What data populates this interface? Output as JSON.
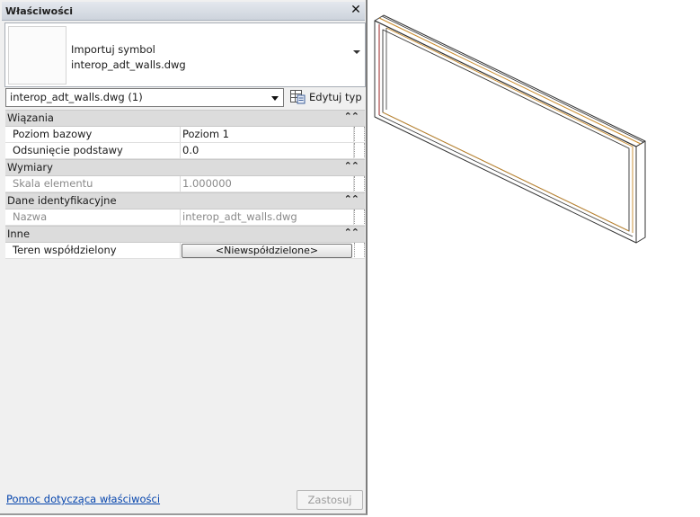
{
  "panel": {
    "title": "Właściwości",
    "close_glyph": "✕",
    "type_selector": {
      "line1": "Importuj symbol",
      "line2": "interop_adt_walls.dwg"
    },
    "instance_select": "interop_adt_walls.dwg (1)",
    "edit_type_label": "Edytuj typ",
    "categories": [
      {
        "name": "Wiązania",
        "rows": [
          {
            "label": "Poziom bazowy",
            "value": "Poziom 1"
          },
          {
            "label": "Odsunięcie podstawy",
            "value": "0.0"
          }
        ]
      },
      {
        "name": "Wymiary",
        "rows": [
          {
            "label": "Skala elementu",
            "value": "1.000000"
          }
        ]
      },
      {
        "name": "Dane identyfikacyjne",
        "rows": [
          {
            "label": "Nazwa",
            "value": "interop_adt_walls.dwg"
          }
        ]
      },
      {
        "name": "Inne",
        "rows": [
          {
            "label": "Teren współdzielony",
            "value": "<Niewspółdzielone>"
          }
        ]
      }
    ],
    "collapse_glyph": "«",
    "help_link": "Pomoc dotycząca właściwości",
    "apply_label": "Zastosuj"
  },
  "icons": {
    "edit_type": "edit-type-icon",
    "dropdown": "chevron-down-icon",
    "collapse": "double-chevron-up-icon"
  },
  "colors": {
    "link": "#0645ad",
    "wall_edge": "#c98a2a",
    "wall_line": "#333333"
  }
}
